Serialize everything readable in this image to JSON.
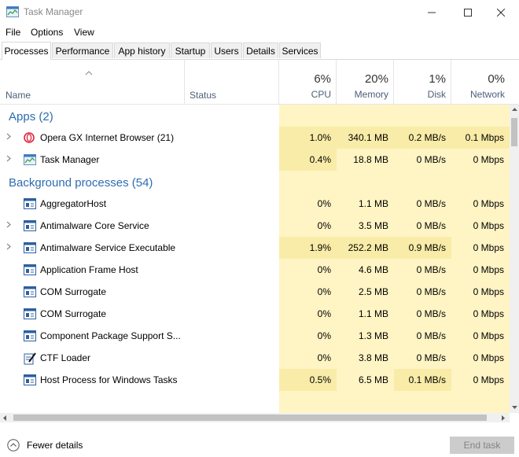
{
  "window": {
    "title": "Task Manager"
  },
  "menu": [
    "File",
    "Options",
    "View"
  ],
  "tabs": [
    "Processes",
    "Performance",
    "App history",
    "Startup",
    "Users",
    "Details",
    "Services"
  ],
  "columns": {
    "name": "Name",
    "status": "Status",
    "cpu": {
      "pct": "6%",
      "label": "CPU"
    },
    "memory": {
      "pct": "20%",
      "label": "Memory"
    },
    "disk": {
      "pct": "1%",
      "label": "Disk"
    },
    "network": {
      "pct": "0%",
      "label": "Network"
    }
  },
  "groups": {
    "apps": "Apps (2)",
    "background": "Background processes (54)"
  },
  "apps": [
    {
      "name": "Opera GX Internet Browser (21)",
      "icon": "opera-icon",
      "expandable": true,
      "cpu": "1.0%",
      "memory": "340.1 MB",
      "disk": "0.2 MB/s",
      "network": "0.1 Mbps"
    },
    {
      "name": "Task Manager",
      "icon": "task-manager-icon",
      "expandable": true,
      "cpu": "0.4%",
      "memory": "18.8 MB",
      "disk": "0 MB/s",
      "network": "0 Mbps"
    }
  ],
  "background": [
    {
      "name": "AggregatorHost",
      "icon": "process-window-icon",
      "expandable": false,
      "cpu": "0%",
      "memory": "1.1 MB",
      "disk": "0 MB/s",
      "network": "0 Mbps"
    },
    {
      "name": "Antimalware Core Service",
      "icon": "process-window-icon",
      "expandable": true,
      "cpu": "0%",
      "memory": "3.5 MB",
      "disk": "0 MB/s",
      "network": "0 Mbps"
    },
    {
      "name": "Antimalware Service Executable",
      "icon": "process-window-icon",
      "expandable": true,
      "cpu": "1.9%",
      "memory": "252.2 MB",
      "disk": "0.9 MB/s",
      "network": "0 Mbps"
    },
    {
      "name": "Application Frame Host",
      "icon": "process-window-icon",
      "expandable": false,
      "cpu": "0%",
      "memory": "4.6 MB",
      "disk": "0 MB/s",
      "network": "0 Mbps"
    },
    {
      "name": "COM Surrogate",
      "icon": "process-window-icon",
      "expandable": false,
      "cpu": "0%",
      "memory": "2.5 MB",
      "disk": "0 MB/s",
      "network": "0 Mbps"
    },
    {
      "name": "COM Surrogate",
      "icon": "process-window-icon",
      "expandable": false,
      "cpu": "0%",
      "memory": "1.1 MB",
      "disk": "0 MB/s",
      "network": "0 Mbps"
    },
    {
      "name": "Component Package Support S...",
      "icon": "process-window-icon",
      "expandable": false,
      "cpu": "0%",
      "memory": "1.3 MB",
      "disk": "0 MB/s",
      "network": "0 Mbps"
    },
    {
      "name": "CTF Loader",
      "icon": "ctf-loader-icon",
      "expandable": false,
      "cpu": "0%",
      "memory": "3.8 MB",
      "disk": "0 MB/s",
      "network": "0 Mbps"
    },
    {
      "name": "Host Process for Windows Tasks",
      "icon": "process-window-icon",
      "expandable": false,
      "cpu": "0.5%",
      "memory": "6.5 MB",
      "disk": "0.1 MB/s",
      "network": "0 Mbps"
    }
  ],
  "footer": {
    "fewer_details": "Fewer details",
    "end_task": "End task"
  },
  "colors": {
    "heat_light": "#fff4c4",
    "heat_medium": "#f9eca8",
    "group_title": "#2d6cb0"
  }
}
